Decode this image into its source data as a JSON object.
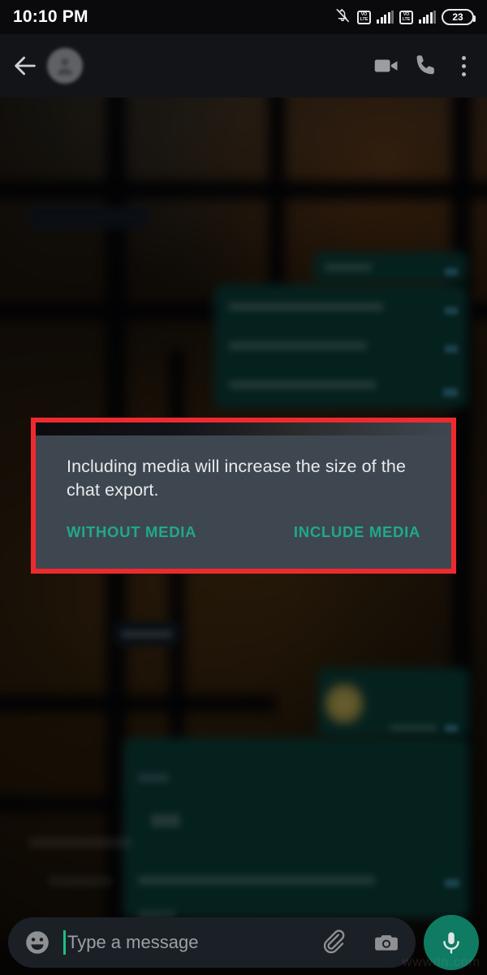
{
  "status_bar": {
    "time": "10:10 PM",
    "battery_percent": "23",
    "icons": [
      "mute-icon",
      "volte-sim1-icon",
      "signal-sim1-icon",
      "volte-sim2-icon",
      "signal-sim2-icon",
      "battery-icon"
    ],
    "volte_label_top": "VO",
    "volte_label_bottom": "LTE"
  },
  "app_bar": {
    "back_label": "Back",
    "contact_name": "",
    "icons": [
      "back-arrow-icon",
      "avatar",
      "video-call-icon",
      "voice-call-icon",
      "overflow-menu-icon"
    ]
  },
  "dialog": {
    "message": "Including media will increase the size of the chat export.",
    "buttons": [
      {
        "label": "WITHOUT MEDIA",
        "name": "without-media-button"
      },
      {
        "label": "INCLUDE MEDIA",
        "name": "include-media-button"
      }
    ],
    "background_color": "#3e4750",
    "button_color": "#1fa98a",
    "highlight_border_color": "#ef2a2f"
  },
  "input_bar": {
    "placeholder": "Type a message",
    "value": "",
    "caret_color": "#1fc07f",
    "mic_button_color": "#0e7b62",
    "icons": [
      "emoji-icon",
      "attachment-icon",
      "camera-icon",
      "mic-icon"
    ]
  },
  "watermark": "wwwdn.com"
}
